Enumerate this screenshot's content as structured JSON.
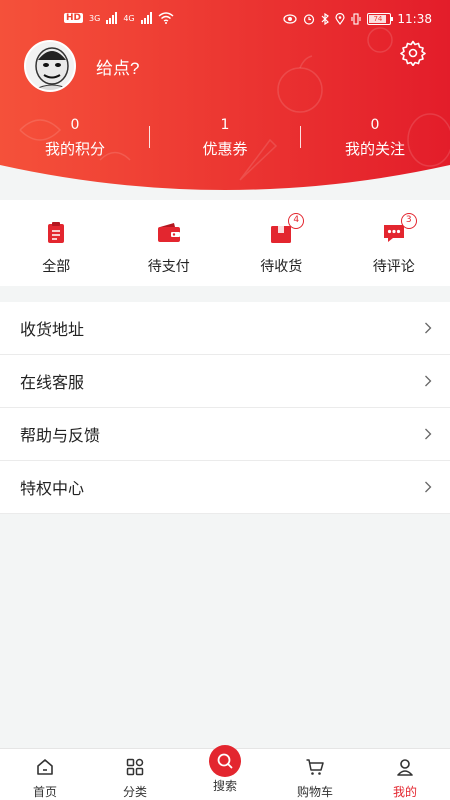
{
  "status_bar": {
    "left_badge": "HD",
    "net1": "3G",
    "net2": "4G",
    "battery": "74",
    "time": "11:38"
  },
  "profile": {
    "username": "给点?",
    "avatar_icon": "avatar-meme-icon",
    "settings_icon": "gear-icon"
  },
  "stats": [
    {
      "value": "0",
      "label": "我的积分"
    },
    {
      "value": "1",
      "label": "优惠券"
    },
    {
      "value": "0",
      "label": "我的关注"
    }
  ],
  "orders": [
    {
      "label": "全部",
      "icon": "clipboard-icon",
      "badge": ""
    },
    {
      "label": "待支付",
      "icon": "wallet-icon",
      "badge": ""
    },
    {
      "label": "待收货",
      "icon": "package-icon",
      "badge": "4"
    },
    {
      "label": "待评论",
      "icon": "chat-bubble-icon",
      "badge": "3"
    }
  ],
  "menu": [
    {
      "label": "收货地址"
    },
    {
      "label": "在线客服"
    },
    {
      "label": "帮助与反馈"
    },
    {
      "label": "特权中心"
    }
  ],
  "tabs": [
    {
      "label": "首页",
      "icon": "home-icon"
    },
    {
      "label": "分类",
      "icon": "category-icon"
    },
    {
      "label": "搜索",
      "icon": "search-icon"
    },
    {
      "label": "购物车",
      "icon": "cart-icon"
    },
    {
      "label": "我的",
      "icon": "user-icon"
    }
  ],
  "colors": {
    "accent": "#e3262f",
    "header_gradient_start": "#f5513a",
    "header_gradient_end": "#e31d2a"
  }
}
